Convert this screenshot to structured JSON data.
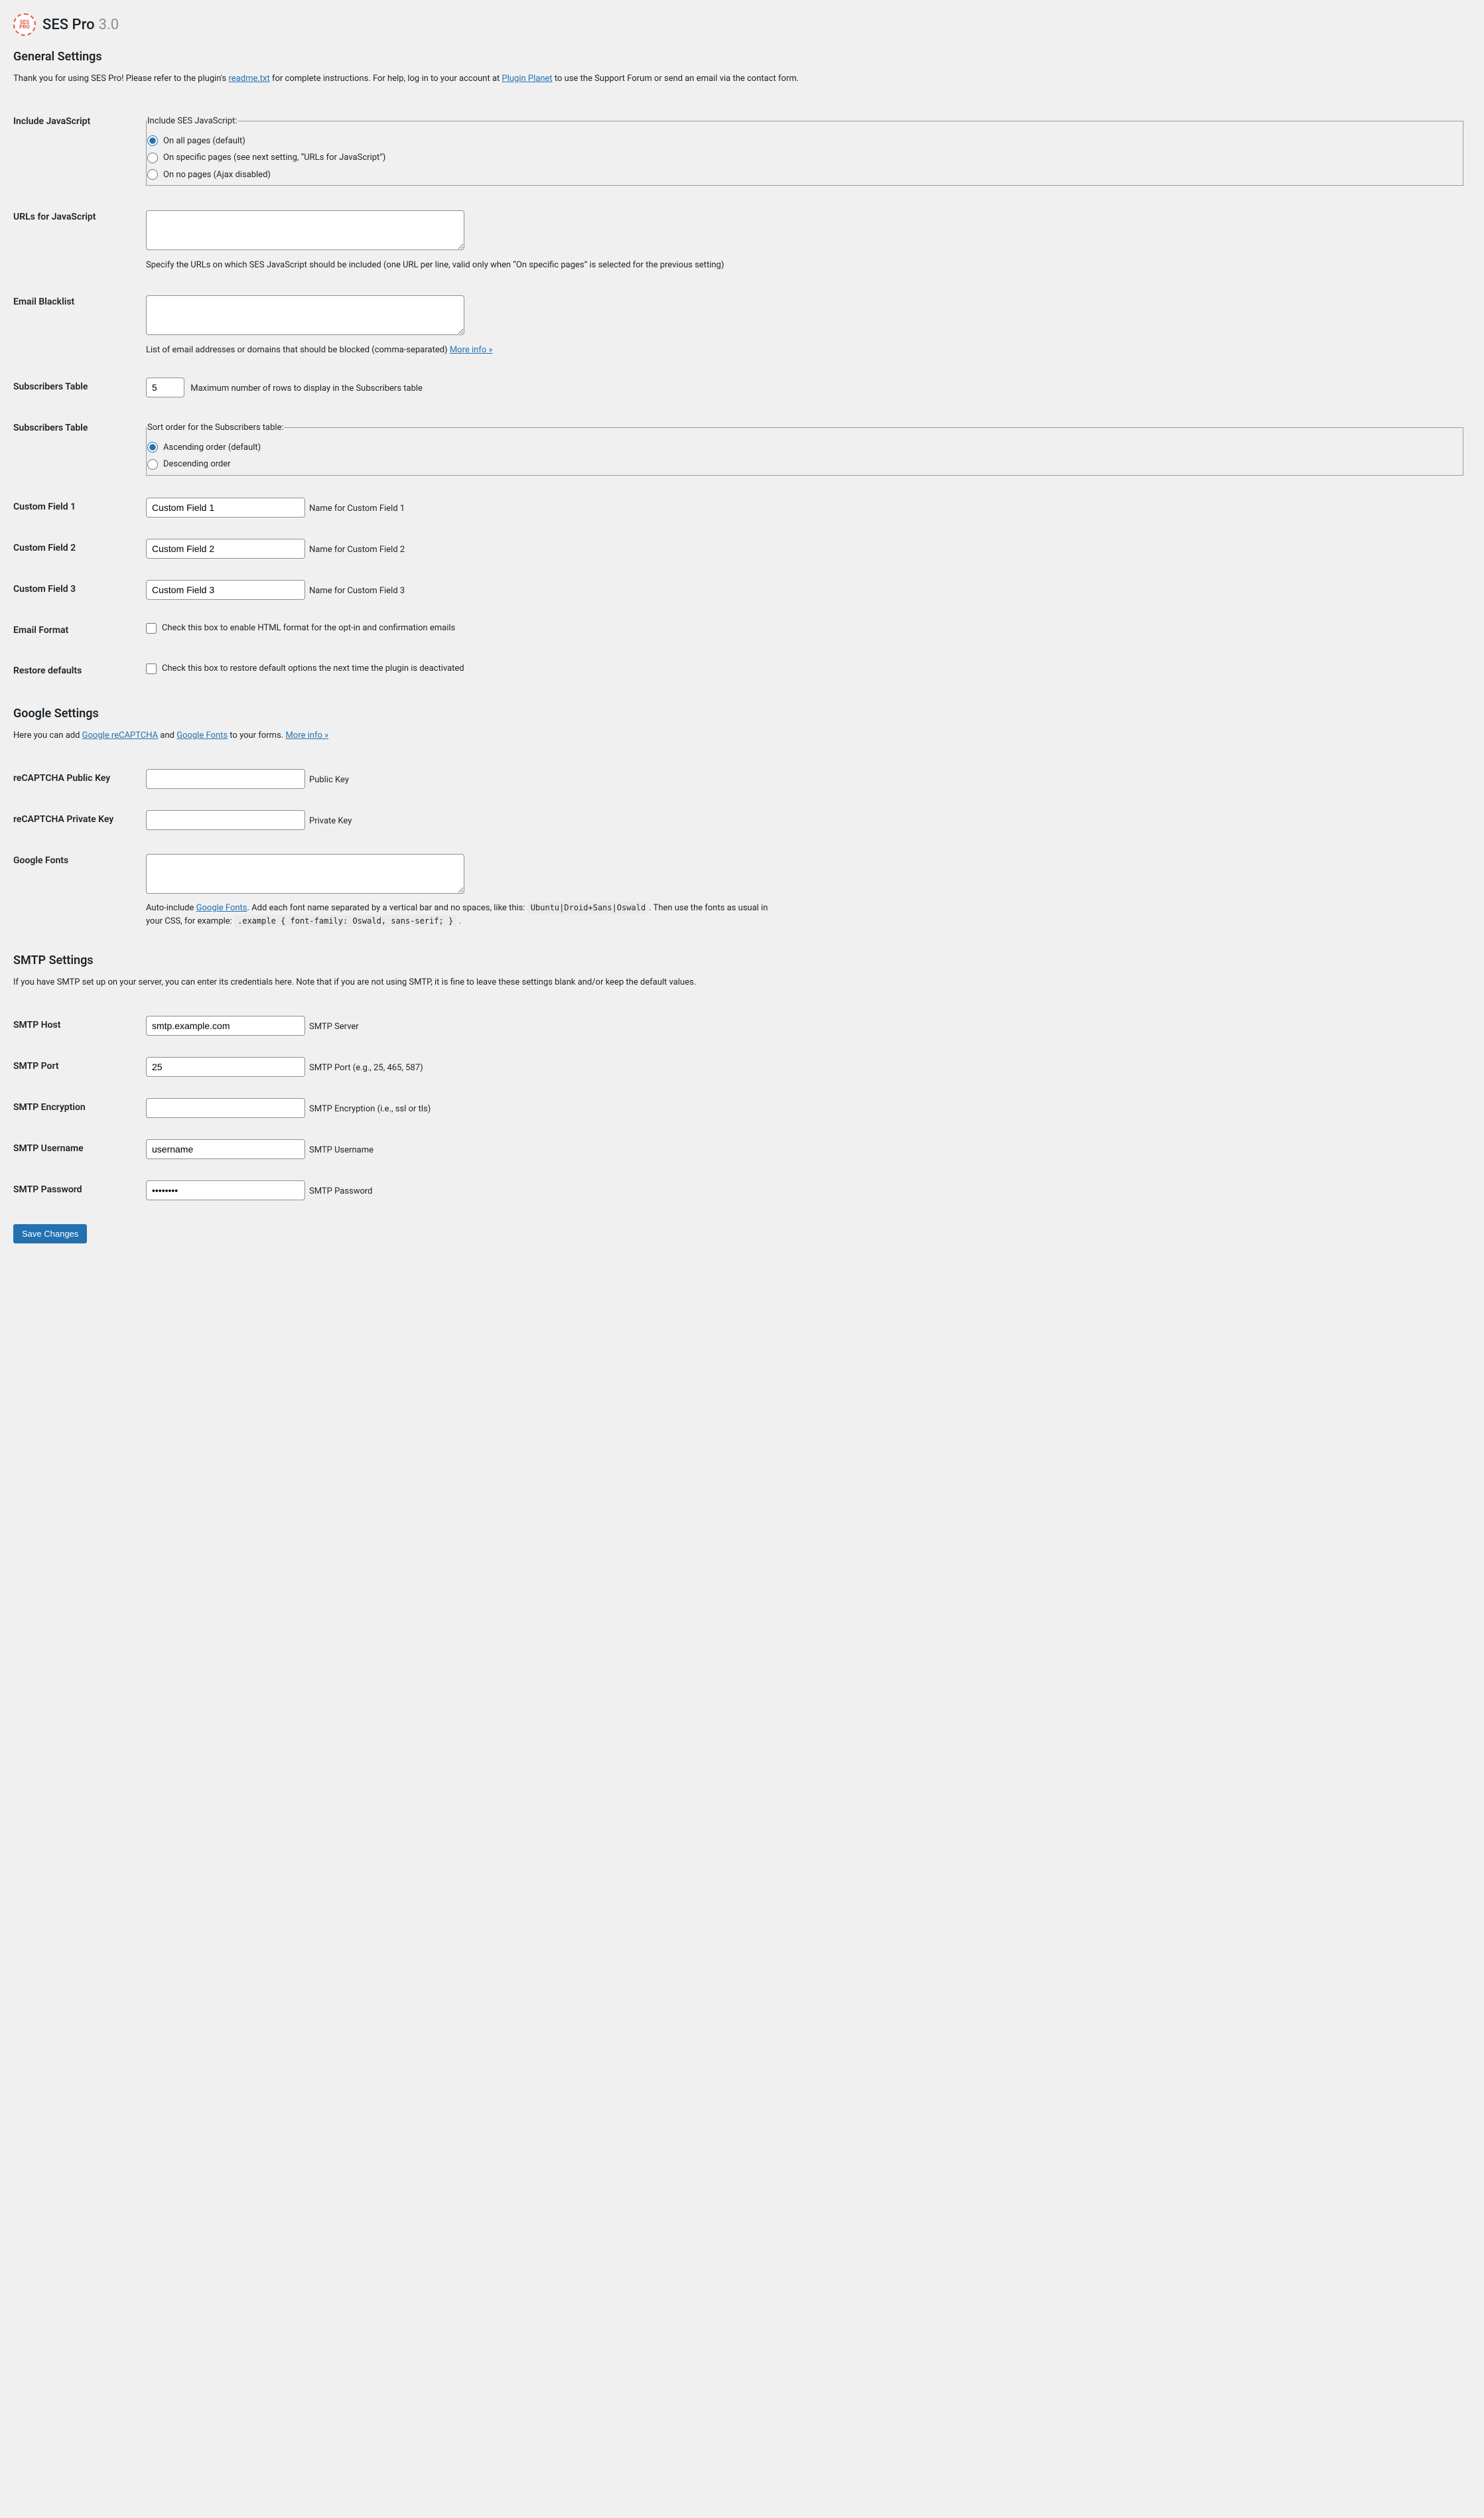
{
  "header": {
    "title": "SES Pro",
    "version": "3.0",
    "logo_text": "SES PRO"
  },
  "general": {
    "heading": "General Settings",
    "intro_prefix": "Thank you for using SES Pro! Please refer to the plugin's ",
    "readme_link": "readme.txt",
    "intro_mid": " for complete instructions. For help, log in to your account at ",
    "planet_link": "Plugin Planet",
    "intro_suffix": " to use the Support Forum or send an email via the contact form.",
    "include_js": {
      "label": "Include JavaScript",
      "legend": "Include SES JavaScript:",
      "opts": {
        "all": "On all pages (default)",
        "specific": "On specific pages (see next setting, “URLs for JavaScript”)",
        "none": "On no pages (Ajax disabled)"
      }
    },
    "urls_js": {
      "label": "URLs for JavaScript",
      "value": "",
      "help": "Specify the URLs on which SES JavaScript should be included (one URL per line, valid only when “On specific pages” is selected for the previous setting)"
    },
    "blacklist": {
      "label": "Email Blacklist",
      "value": "",
      "help_prefix": "List of email addresses or domains that should be blocked (comma-separated) ",
      "more_info": "More info »"
    },
    "rows": {
      "label": "Subscribers Table",
      "value": "5",
      "help": "Maximum number of rows to display in the Subscribers table"
    },
    "sort": {
      "label": "Subscribers Table",
      "legend": "Sort order for the Subscribers table:",
      "asc": "Ascending order (default)",
      "desc": "Descending order"
    },
    "cf1": {
      "label": "Custom Field 1",
      "value": "Custom Field 1",
      "help": "Name for Custom Field 1"
    },
    "cf2": {
      "label": "Custom Field 2",
      "value": "Custom Field 2",
      "help": "Name for Custom Field 2"
    },
    "cf3": {
      "label": "Custom Field 3",
      "value": "Custom Field 3",
      "help": "Name for Custom Field 3"
    },
    "html_format": {
      "label": "Email Format",
      "help": "Check this box to enable HTML format for the opt-in and confirmation emails"
    },
    "restore": {
      "label": "Restore defaults",
      "help": "Check this box to restore default options the next time the plugin is deactivated"
    }
  },
  "google": {
    "heading": "Google Settings",
    "intro_prefix": "Here you can add ",
    "recaptcha_link": "Google reCAPTCHA",
    "intro_and": " and ",
    "fonts_link": "Google Fonts",
    "intro_suffix": " to your forms. ",
    "more_info": "More info »",
    "public": {
      "label": "reCAPTCHA Public Key",
      "value": "",
      "help": "Public Key"
    },
    "private": {
      "label": "reCAPTCHA Private Key",
      "value": "",
      "help": "Private Key"
    },
    "fonts": {
      "label": "Google Fonts",
      "value": "",
      "help_prefix": "Auto-include ",
      "help_link": "Google Fonts",
      "help_mid": ". Add each font name separated by a vertical bar and no spaces, like this: ",
      "code1": "Ubuntu|Droid+Sans|Oswald",
      "help_mid2": ". Then use the fonts as usual in your CSS, for example: ",
      "code2": ".example { font-family: Oswald, sans-serif; }",
      "help_suffix": " ."
    }
  },
  "smtp": {
    "heading": "SMTP Settings",
    "intro": "If you have SMTP set up on your server, you can enter its credentials here. Note that if you are not using SMTP, it is fine to leave these settings blank and/or keep the default values.",
    "host": {
      "label": "SMTP Host",
      "value": "smtp.example.com",
      "help": "SMTP Server"
    },
    "port": {
      "label": "SMTP Port",
      "value": "25",
      "help": "SMTP Port (e.g., 25, 465, 587)"
    },
    "enc": {
      "label": "SMTP Encryption",
      "value": "",
      "help": "SMTP Encryption (i.e., ssl or tls)"
    },
    "user": {
      "label": "SMTP Username",
      "value": "username",
      "help": "SMTP Username"
    },
    "pass": {
      "label": "SMTP Password",
      "value": "••••••••",
      "help": "SMTP Password"
    }
  },
  "submit": {
    "label": "Save Changes"
  }
}
